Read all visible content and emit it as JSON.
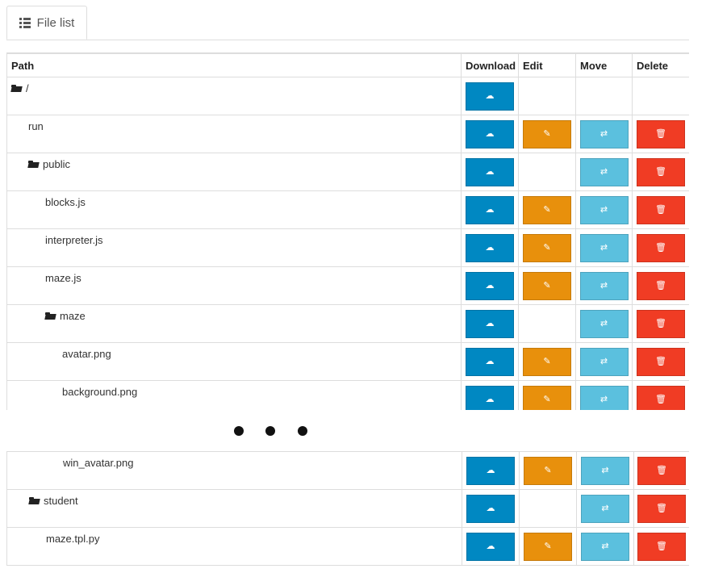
{
  "tab": {
    "label": "File list",
    "icon": "list-icon"
  },
  "columns": {
    "path": "Path",
    "download": "Download",
    "edit": "Edit",
    "move": "Move",
    "delete": "Delete"
  },
  "icons": {
    "download": "☁",
    "edit": "✎",
    "move": "⇄",
    "delete": "🗑"
  },
  "colors": {
    "download": "#0088c2",
    "edit": "#e8900c",
    "move": "#5bc0de",
    "delete": "#f03c24"
  },
  "rows_top": [
    {
      "name": "/",
      "folder": true,
      "level": 0,
      "edit": false,
      "move": false,
      "delete": false
    },
    {
      "name": "run",
      "folder": false,
      "level": 1,
      "edit": true,
      "move": true,
      "delete": true
    },
    {
      "name": "public",
      "folder": true,
      "level": 1,
      "edit": false,
      "move": true,
      "delete": true
    },
    {
      "name": "blocks.js",
      "folder": false,
      "level": 2,
      "edit": true,
      "move": true,
      "delete": true
    },
    {
      "name": "interpreter.js",
      "folder": false,
      "level": 2,
      "edit": true,
      "move": true,
      "delete": true
    },
    {
      "name": "maze.js",
      "folder": false,
      "level": 2,
      "edit": true,
      "move": true,
      "delete": true
    },
    {
      "name": "maze",
      "folder": true,
      "level": 2,
      "edit": false,
      "move": true,
      "delete": true
    },
    {
      "name": "avatar.png",
      "folder": false,
      "level": 3,
      "edit": true,
      "move": true,
      "delete": true
    },
    {
      "name": "background.png",
      "folder": false,
      "level": 3,
      "edit": true,
      "move": true,
      "delete": true
    }
  ],
  "rows_bottom": [
    {
      "name": "win_avatar.png",
      "folder": false,
      "level": 3,
      "edit": true,
      "move": true,
      "delete": true
    },
    {
      "name": "student",
      "folder": true,
      "level": 1,
      "edit": false,
      "move": true,
      "delete": true
    },
    {
      "name": "maze.tpl.py",
      "folder": false,
      "level": 2,
      "edit": true,
      "move": true,
      "delete": true
    }
  ]
}
